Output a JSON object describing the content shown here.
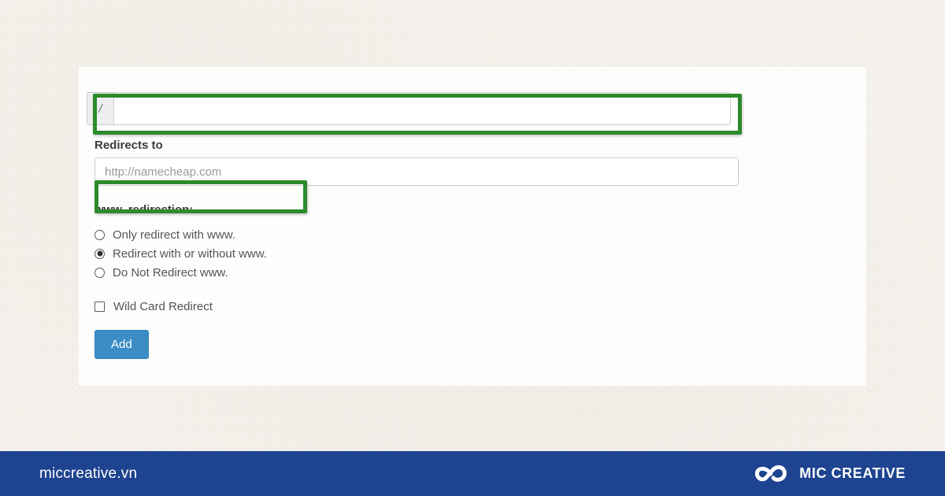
{
  "form": {
    "path_input": {
      "addon": "/",
      "value": "",
      "placeholder": ""
    },
    "redirects_to_label": "Redirects to",
    "redirect_input": {
      "value": "",
      "placeholder": "http://namecheap.com"
    },
    "www_section_label": "www. redirection:",
    "www_options": [
      {
        "label": "Only redirect with www.",
        "selected": false
      },
      {
        "label": "Redirect with or without www.",
        "selected": true
      },
      {
        "label": "Do Not Redirect www.",
        "selected": false
      }
    ],
    "wildcard": {
      "label": "Wild Card Redirect",
      "checked": false
    },
    "submit_label": "Add"
  },
  "annotations": {
    "highlight_color": "#2d8a2d",
    "boxes": [
      {
        "name": "path-input-highlight"
      },
      {
        "name": "redirect-input-highlight"
      }
    ]
  },
  "footer": {
    "site": "miccreative.vn",
    "brand": "MIC CREATIVE",
    "background": "#1e4390"
  },
  "theme": {
    "accent_button": "#3c8dc5",
    "panel_background": "#fdfdfc",
    "page_background": "#f7f5ef"
  }
}
